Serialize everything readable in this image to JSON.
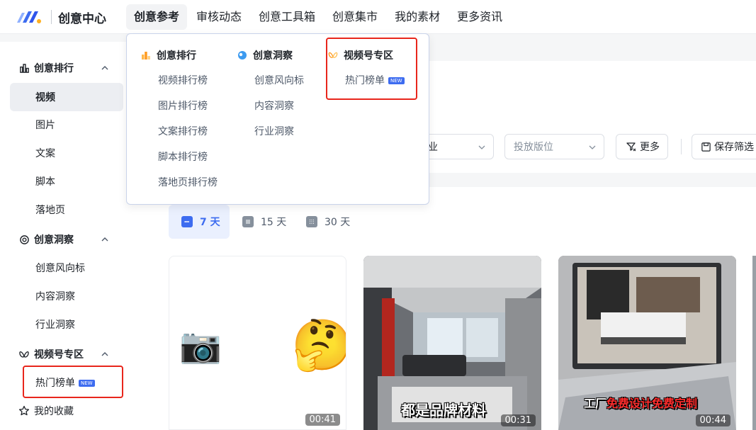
{
  "brand": {
    "name": "创意中心",
    "logo": "brand-logo"
  },
  "nav": {
    "items": [
      "创意参考",
      "审核动态",
      "创意工具箱",
      "创意集市",
      "我的素材",
      "更多资讯"
    ],
    "active": "创意参考"
  },
  "sidebar": {
    "groups": [
      {
        "label": "创意排行",
        "icon": "bar-chart-icon",
        "items": [
          "视频",
          "图片",
          "文案",
          "脚本",
          "落地页"
        ],
        "active": "视频"
      },
      {
        "label": "创意洞察",
        "icon": "insight-icon",
        "items": [
          "创意风向标",
          "内容洞察",
          "行业洞察"
        ]
      },
      {
        "label": "视频号专区",
        "icon": "butterfly-icon",
        "items": [
          "热门榜单"
        ]
      }
    ],
    "favorites": {
      "label": "我的收藏",
      "icon": "star-icon"
    },
    "new_badge": "NEW"
  },
  "dropdown": {
    "columns": [
      {
        "title": "创意排行",
        "icon": "ranking-icon",
        "items": [
          "视频排行榜",
          "图片排行榜",
          "文案排行榜",
          "脚本排行榜",
          "落地页排行榜"
        ]
      },
      {
        "title": "创意洞察",
        "icon": "insight-icon",
        "items": [
          "创意风向标",
          "内容洞察",
          "行业洞察"
        ]
      },
      {
        "title": "视频号专区",
        "icon": "butterfly-icon",
        "items": [
          "热门榜单"
        ]
      }
    ],
    "new_badge": "NEW"
  },
  "filters": {
    "industry_partial": "业",
    "placement_placeholder": "投放版位",
    "more": "更多",
    "save": "保存筛选"
  },
  "time_tabs": [
    {
      "label": "7 天",
      "active": true
    },
    {
      "label": "15 天",
      "active": false
    },
    {
      "label": "30 天",
      "active": false
    }
  ],
  "videos": [
    {
      "duration": "00:41",
      "caption": "",
      "emoji": [
        "📷",
        "🤔"
      ]
    },
    {
      "duration": "00:31",
      "caption": "都是品牌材料"
    },
    {
      "duration": "00:44",
      "caption_white": "工厂",
      "caption_red": "免费设计免费定制"
    }
  ],
  "colors": {
    "accent": "#3d6cf0",
    "highlight_border": "#e8261c",
    "active_tab_bg": "#eaf0fe",
    "caption_red": "#ff2d2d"
  }
}
